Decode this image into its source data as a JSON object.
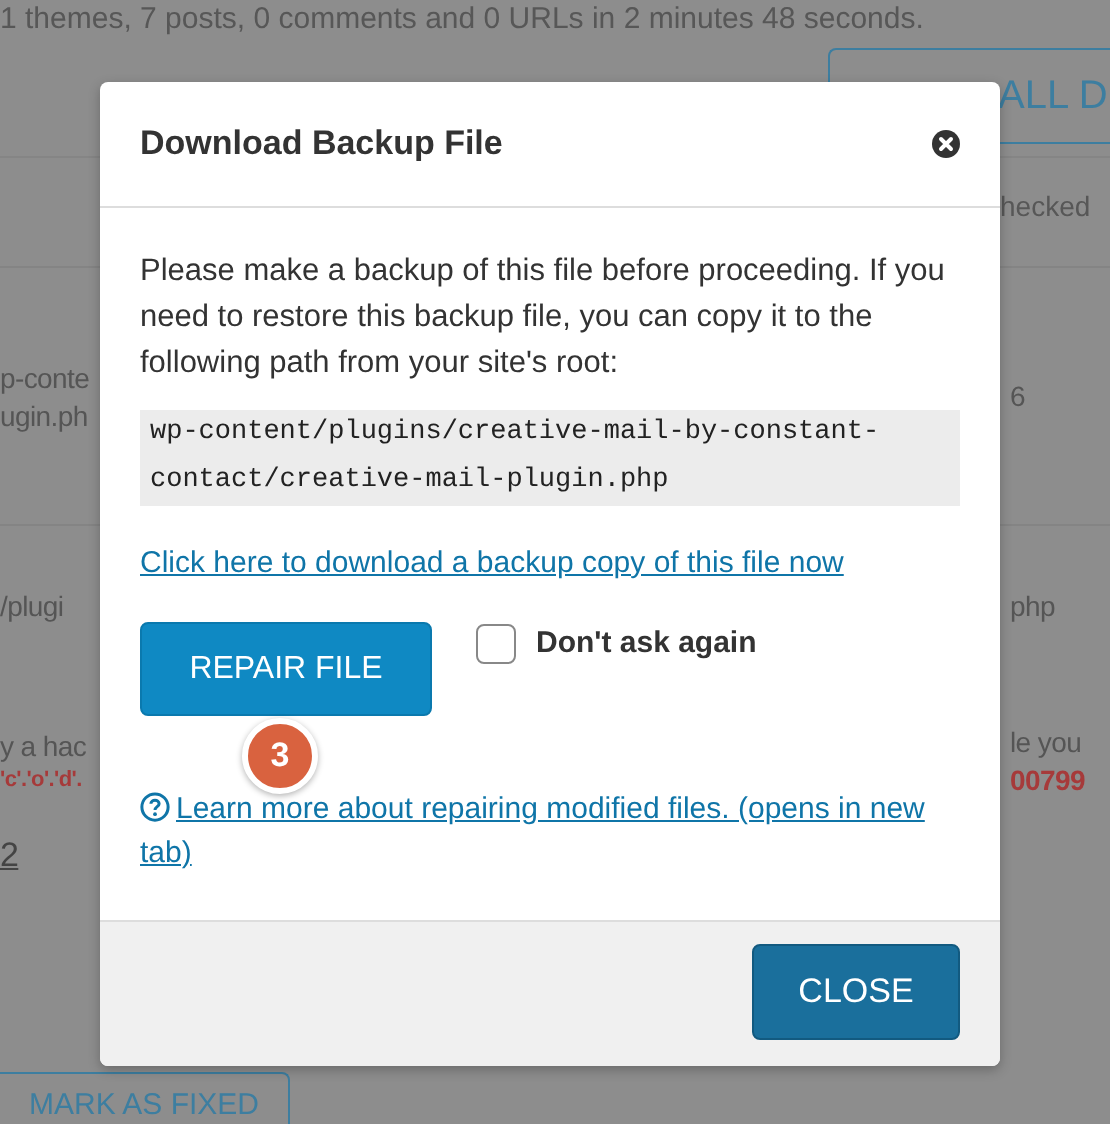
{
  "background": {
    "scan_summary": "1 themes, 7 posts, 0 comments and 0 URLs in 2 minutes 48 seconds.",
    "top_button": "ALL D",
    "checked_label": "hecked",
    "rows": [
      {
        "left": [
          {
            "kind": "plain",
            "text": "p-conte"
          },
          {
            "kind": "plain",
            "text": "ugin.ph"
          }
        ],
        "right": [
          {
            "kind": "plain",
            "text": "6"
          }
        ]
      },
      {
        "left": [
          {
            "kind": "plain",
            "text": "/plugi"
          }
        ],
        "right": [
          {
            "kind": "plain",
            "text": "php"
          }
        ]
      },
      {
        "left": [
          {
            "kind": "plain",
            "text": "y a hac"
          },
          {
            "kind": "code",
            "text": "'c'.'o'.'d'."
          }
        ],
        "right": [
          {
            "kind": "plain",
            "text": "le you"
          },
          {
            "kind": "code",
            "text": "00799"
          }
        ]
      },
      {
        "left": [
          {
            "kind": "link",
            "text": "2"
          }
        ]
      }
    ],
    "bottom_button": "MARK AS FIXED"
  },
  "dialog": {
    "title": "Download Backup File",
    "message": "Please make a backup of this file before proceeding. If you need to restore this backup file, you can copy it to the following path from your site's root:",
    "path": "wp-content/plugins/creative-mail-by-constant-contact/creative-mail-plugin.php",
    "download_link": "Click here to download a backup copy of this file now",
    "repair_button": "REPAIR FILE",
    "step_badge": "3",
    "dont_ask": {
      "label": "Don't ask again",
      "checked": false
    },
    "help_link": "Learn more about repairing modified files. (opens in new tab)",
    "close_button": "CLOSE"
  }
}
